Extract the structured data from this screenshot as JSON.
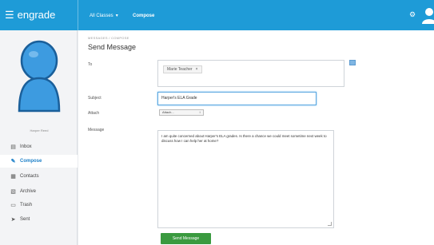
{
  "header": {
    "logo": "engrade",
    "nav_classes": "All Classes",
    "nav_compose": "Compose"
  },
  "sidebar": {
    "profile_name": "Harper Reed",
    "items": [
      {
        "label": "Inbox",
        "icon": "inbox-icon",
        "active": false
      },
      {
        "label": "Compose",
        "icon": "pencil-icon",
        "active": true
      },
      {
        "label": "Contacts",
        "icon": "contacts-icon",
        "active": false
      },
      {
        "label": "Archive",
        "icon": "folder-icon",
        "active": false
      },
      {
        "label": "Trash",
        "icon": "trash-icon",
        "active": false
      },
      {
        "label": "Sent",
        "icon": "send-icon",
        "active": false
      }
    ]
  },
  "main": {
    "breadcrumb": "MESSAGES / COMPOSE",
    "title": "Send Message",
    "to_label": "To",
    "to_recipient": "Marie Teacher",
    "subject_label": "Subject",
    "subject_value": "Harper's ELA Grade",
    "attach_label": "Attach",
    "attach_value": "Attach...",
    "message_label": "Message",
    "message_value": "I am quite concerned about Harper's ELA grades. Is there a chance we could meet sometime next week to discuss how I can help her at home?",
    "send_label": "Send Message"
  },
  "colors": {
    "accent": "#1e9bd7",
    "send_button": "#3a9a3f"
  }
}
